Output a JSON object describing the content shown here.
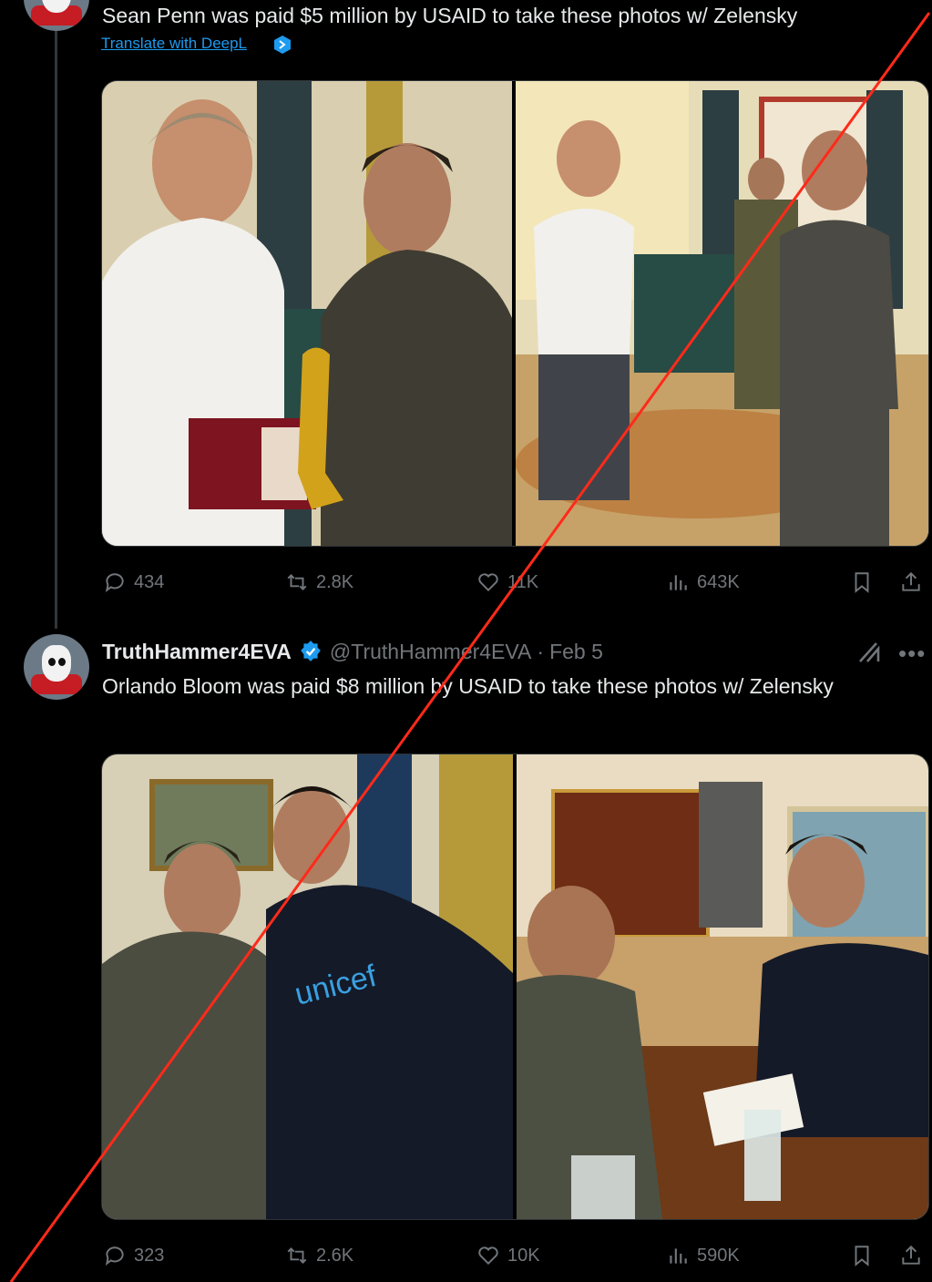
{
  "tweet1": {
    "text": "Sean Penn was paid $5 million by USAID to take these photos w/ Zelensky",
    "translate_label": "Translate with DeepL",
    "stats": {
      "replies": "434",
      "reposts": "2.8K",
      "likes": "11K",
      "views": "643K"
    }
  },
  "tweet2": {
    "display_name": "TruthHammer4EVA",
    "handle": "@TruthHammer4EVA",
    "separator": "·",
    "date": "Feb 5",
    "text": "Orlando Bloom was paid $8 million by USAID to take these photos w/ Zelensky",
    "stats": {
      "replies": "323",
      "reposts": "2.6K",
      "likes": "10K",
      "views": "590K"
    }
  },
  "colors": {
    "background": "#000000",
    "text": "#e7e9ea",
    "muted": "#71767b",
    "link": "#1d9bf0",
    "overlay_line": "#ff2a1a"
  },
  "icons": [
    "reply-icon",
    "repost-icon",
    "like-icon",
    "views-icon",
    "bookmark-icon",
    "share-icon",
    "verified-badge-icon",
    "grok-icon",
    "more-icon",
    "deepl-icon"
  ]
}
